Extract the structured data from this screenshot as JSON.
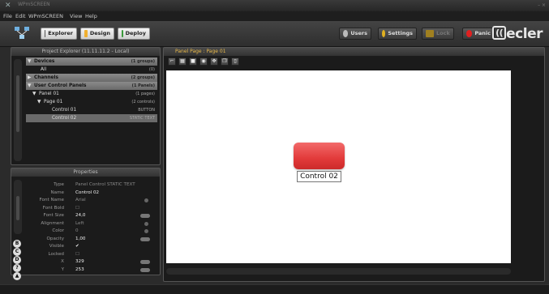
{
  "titlebar": {
    "title": "WPmSCREEN",
    "window_controls": "– ×"
  },
  "menubar": {
    "items": [
      "File",
      "Edit",
      "WPmSCREEN",
      "View",
      "Help"
    ]
  },
  "toolbar": {
    "explorer_label": "Explorer",
    "design_label": "Design",
    "deploy_label": "Deploy",
    "users_label": "Users",
    "settings_label": "Settings",
    "lock_label": "Lock",
    "panic_label": "Panic",
    "brand": "ecler"
  },
  "explorer": {
    "title": "Project Explorer (11.11.11.2 - Local)",
    "rows": [
      {
        "label": "Devices",
        "right": "(1 groups)",
        "kind": "section",
        "arrow": "▼"
      },
      {
        "label": "All",
        "right": "(0)",
        "kind": "item",
        "arrow": ""
      },
      {
        "label": "Channels",
        "right": "(2 groups)",
        "kind": "section",
        "arrow": "▶"
      },
      {
        "label": "User Control Panels",
        "right": "(1 Panels)",
        "kind": "section",
        "arrow": "▼"
      },
      {
        "label": "Panel 01",
        "right": "(1 pages)",
        "kind": "item",
        "arrow": "▼"
      },
      {
        "label": "Page 01",
        "right": "(2 controls)",
        "kind": "item",
        "arrow": "▼"
      },
      {
        "label": "Control 01",
        "right": "BUTTON",
        "kind": "item",
        "arrow": ""
      },
      {
        "label": "Control 02",
        "right": "STATIC TEXT",
        "kind": "selected",
        "arrow": ""
      }
    ]
  },
  "properties": {
    "title": "Properties",
    "rows": [
      {
        "key": "Type",
        "value": "Panel Control STATIC TEXT",
        "grey": true,
        "ctl": ""
      },
      {
        "key": "Name",
        "value": "Control 02",
        "grey": false,
        "ctl": ""
      },
      {
        "key": "Font Name",
        "value": "Arial",
        "grey": true,
        "ctl": "dot"
      },
      {
        "key": "Font Bold",
        "value": "☐",
        "grey": true,
        "ctl": ""
      },
      {
        "key": "Font Size",
        "value": "24,0",
        "grey": false,
        "ctl": "pill"
      },
      {
        "key": "Alignment",
        "value": "Left",
        "grey": true,
        "ctl": "dot"
      },
      {
        "key": "Color",
        "value": "0",
        "grey": true,
        "ctl": "dot"
      },
      {
        "key": "Opacity",
        "value": "1,00",
        "grey": false,
        "ctl": "pill"
      },
      {
        "key": "Visible",
        "value": "✔",
        "grey": false,
        "ctl": ""
      },
      {
        "key": "Locked",
        "value": "☐",
        "grey": true,
        "ctl": ""
      },
      {
        "key": "X",
        "value": "329",
        "grey": false,
        "ctl": "pill"
      },
      {
        "key": "Y",
        "value": "253",
        "grey": false,
        "ctl": "pill"
      }
    ],
    "side_buttons": [
      "B",
      "C",
      "D",
      "?",
      "▲"
    ]
  },
  "canvas": {
    "title": "Panel Page : Page 01",
    "control_label": "Control 02",
    "button_color": "#e23a3a"
  },
  "statusbar": {
    "left": "",
    "right": ""
  }
}
